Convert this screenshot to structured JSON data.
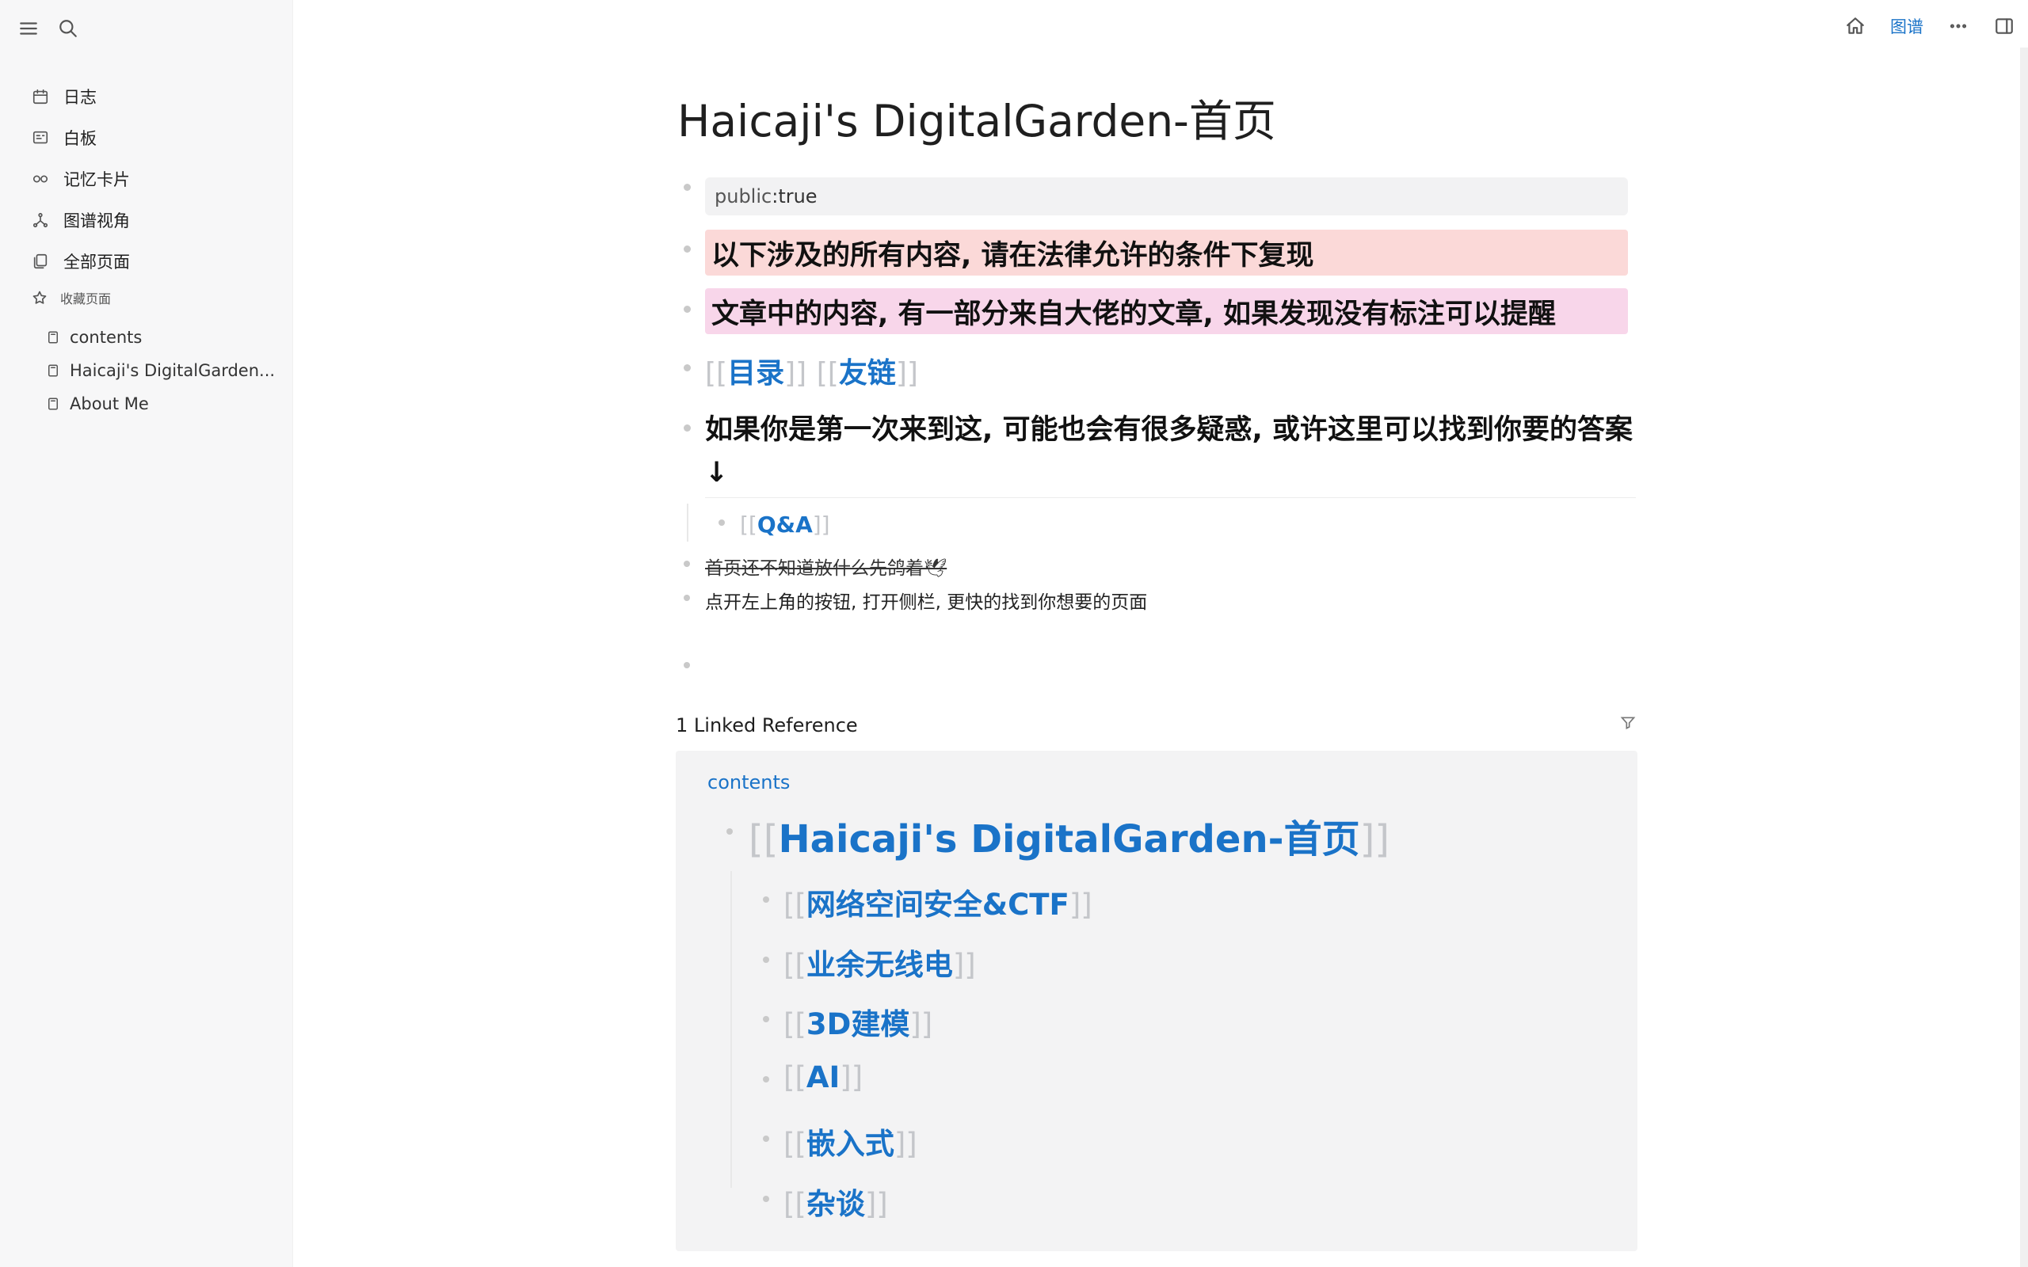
{
  "sidebar": {
    "nav": [
      {
        "label": "日志",
        "icon": "calendar-icon"
      },
      {
        "label": "白板",
        "icon": "whiteboard-icon"
      },
      {
        "label": "记忆卡片",
        "icon": "infinity-icon"
      },
      {
        "label": "图谱视角",
        "icon": "graph-icon"
      },
      {
        "label": "全部页面",
        "icon": "pages-icon"
      }
    ],
    "favorites_title": "收藏页面",
    "favorites": [
      {
        "label": "contents"
      },
      {
        "label": "Haicaji's DigitalGarden..."
      },
      {
        "label": "About Me"
      }
    ]
  },
  "toolbar": {
    "graph_label": "图谱"
  },
  "page": {
    "title": "Haicaji's DigitalGarden-首页",
    "property": {
      "key": "public",
      "sep": ":",
      "value": " true"
    },
    "notice_red": "以下涉及的所有内容, 请在法律允许的条件下复现",
    "notice_pink": "文章中的内容, 有一部分来自大佬的文章, 如果发现没有标注可以提醒",
    "link_catalog": "目录",
    "link_friends": "友链",
    "intro": "如果你是第一次来到这, 可能也会有很多疑惑, 或许这里可以找到你要的答案↓",
    "qa_link": "Q&A",
    "strike_text": "首页还不知道放什么先鸽着🕊",
    "tip_text": "点开左上角的按钮, 打开侧栏, 更快的找到你想要的页面"
  },
  "references": {
    "title": "1 Linked Reference",
    "source_page": "contents",
    "main_link": "Haicaji's DigitalGarden-首页",
    "sub_links": [
      {
        "label": "网络空间安全&CTF"
      },
      {
        "label": "业余无线电"
      },
      {
        "label": "3D建模"
      },
      {
        "label": "AI"
      },
      {
        "label": "嵌入式"
      },
      {
        "label": "杂谈"
      }
    ]
  },
  "colors": {
    "link": "#1a73c8",
    "highlight_red": "#fbd9d8",
    "highlight_pink": "#f8d6ea"
  }
}
